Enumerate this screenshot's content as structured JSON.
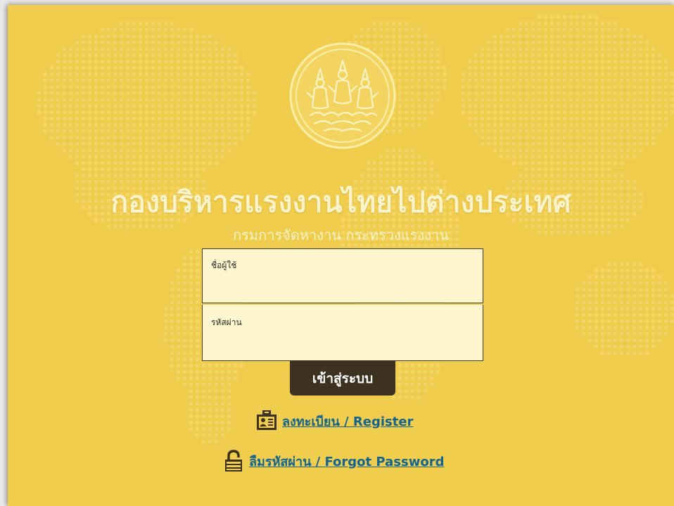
{
  "app": {
    "title": "กองบริหารแรงงานไทยไปต่างประเทศ",
    "subtitle": "กรมการจัดหางาน กระทรวงแรงงาน"
  },
  "login_form": {
    "username_placeholder": "ชื่อผู้ใช้",
    "password_placeholder": "รหัสผ่าน",
    "username_value": "",
    "password_value": "",
    "submit_label": "เข้าสู่ระบบ"
  },
  "links": {
    "register_label": "ลงทะเบียน / Register",
    "register_icon": "id-card-icon",
    "forgot_label": "ลืมรหัสผ่าน / Forgot Password",
    "forgot_icon": "lock-icon"
  },
  "colors": {
    "background": "#f1cd4e",
    "title_text": "#fbf3c9",
    "field_bg": "#fdf6cf",
    "button_bg": "#3d3220",
    "link": "#13658f",
    "icon": "#3d3220"
  }
}
